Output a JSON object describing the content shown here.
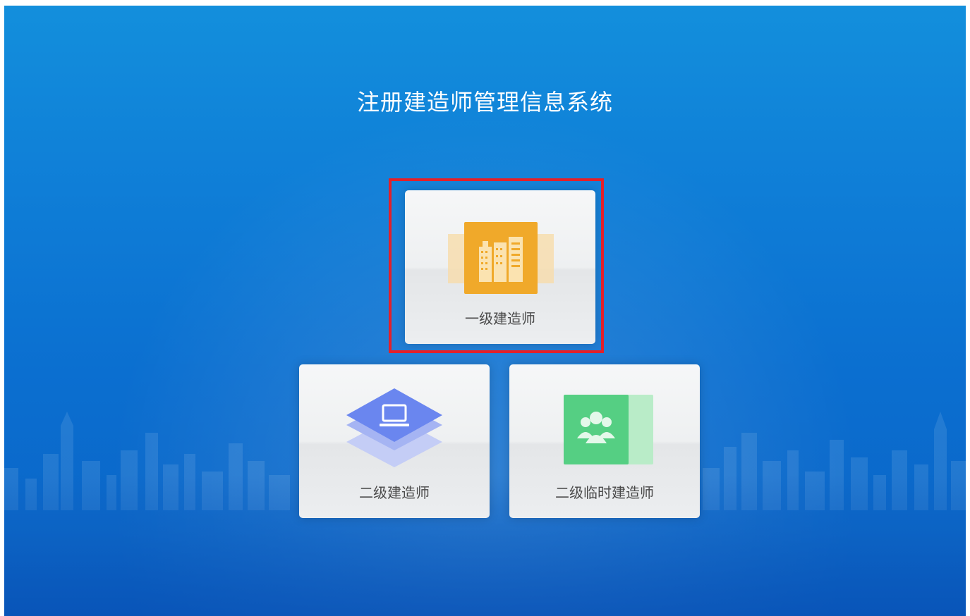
{
  "page": {
    "title": "注册建造师管理信息系统"
  },
  "cards": [
    {
      "label": "一级建造师",
      "icon": "buildings-icon",
      "color": "#f0a92a"
    },
    {
      "label": "二级建造师",
      "icon": "computer-layers-icon",
      "color": "#6a86ef"
    },
    {
      "label": "二级临时建造师",
      "icon": "people-group-icon",
      "color": "#55cf83"
    }
  ],
  "highlight": {
    "color": "#e3202a",
    "target": "一级建造师"
  }
}
